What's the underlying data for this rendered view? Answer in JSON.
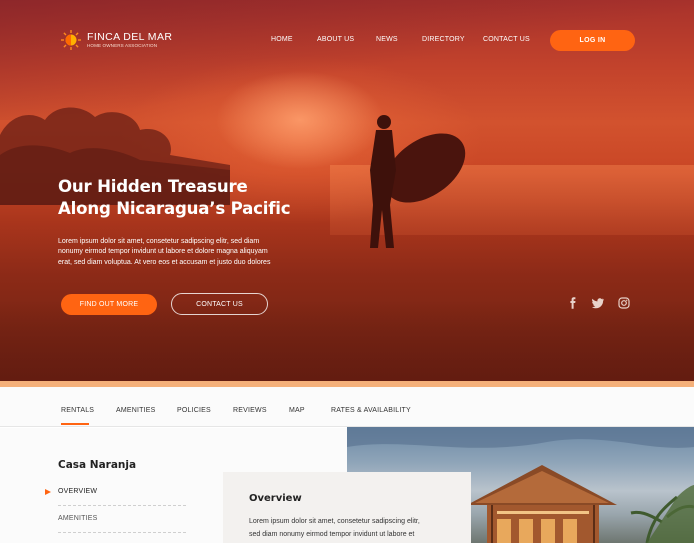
{
  "brand": {
    "name": "FINCA DEL MAR",
    "tagline": "HOME OWNERS ASSOCIATION",
    "logo_icon": "sun-logo-icon",
    "accent": "#ff6412"
  },
  "nav": {
    "items": [
      "HOME",
      "ABOUT US",
      "NEWS",
      "DIRECTORY",
      "CONTACT US"
    ],
    "login_label": "LOG IN"
  },
  "hero": {
    "title_line1": "Our Hidden Treasure",
    "title_line2": "Along Nicaragua’s Pacific",
    "text_line1": "Lorem ipsum dolor sit amet, consetetur sadipscing elitr, sed diam",
    "text_line2": "nonumy eirmod tempor invidunt ut labore et dolore magna aliquyam",
    "text_line3": "erat, sed diam voluptua. At vero eos et accusam et justo duo dolores",
    "primary_button": "FIND OUT MORE",
    "secondary_button": "CONTACT US",
    "social_icons": [
      "facebook-icon",
      "twitter-icon",
      "instagram-icon"
    ]
  },
  "tabs": {
    "items": [
      "RENTALS",
      "AMENITIES",
      "POLICIES",
      "REVIEWS",
      "MAP",
      "RATES & AVAILABILITY"
    ],
    "active": "RENTALS"
  },
  "property": {
    "name": "Casa Naranja",
    "sidebar_items": [
      "OVERVIEW",
      "AMENITIES"
    ],
    "active_item": "OVERVIEW"
  },
  "overview": {
    "title": "Overview",
    "text_line1": "Lorem ipsum dolor sit amet, consetetur sadipscing elitr,",
    "text_line2": "sed diam nonumy eirmod tempor invidunt ut labore et"
  }
}
